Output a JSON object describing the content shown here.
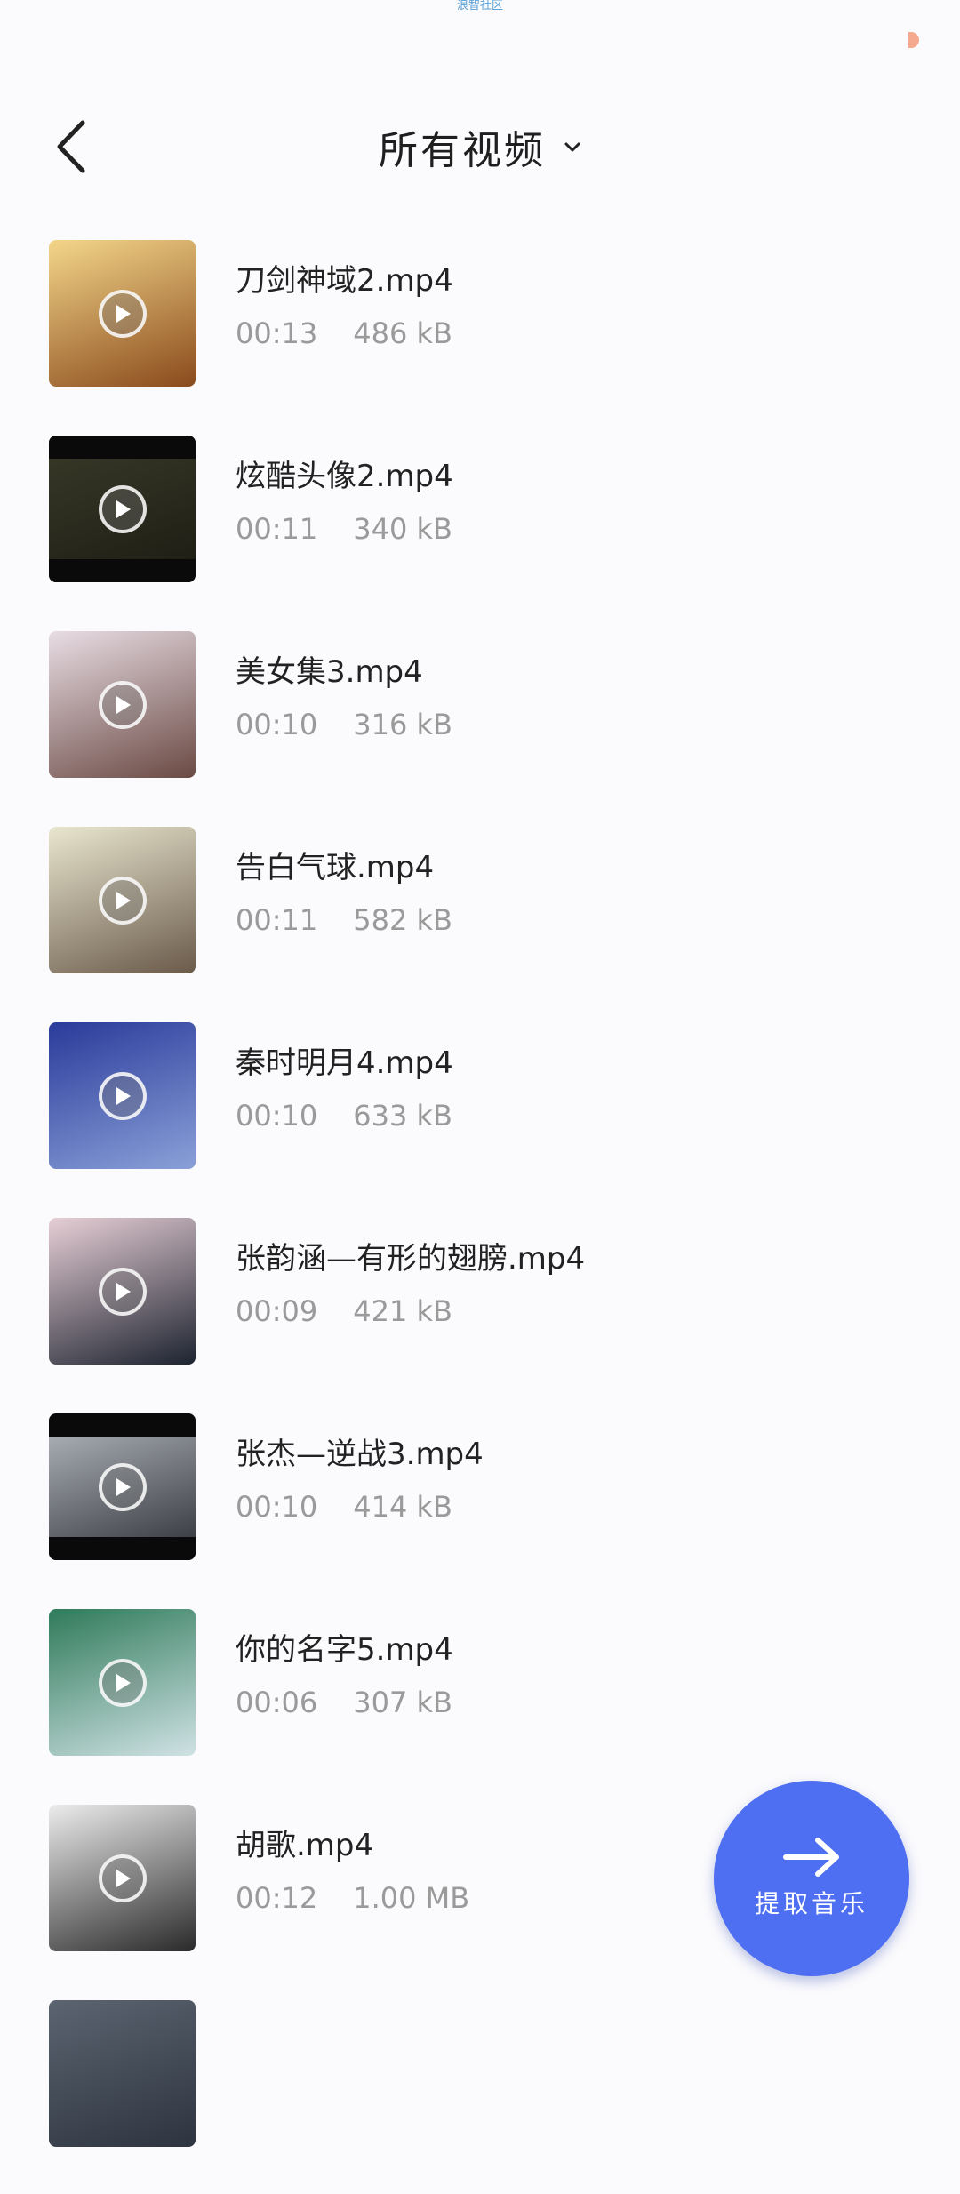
{
  "status": {
    "watermark_text": "浪智社区"
  },
  "header": {
    "title": "所有视频",
    "back_icon": "chevron-left-icon",
    "dropdown_icon": "chevron-down-icon"
  },
  "videos": [
    {
      "title": "刀剑神域2.mp4",
      "duration": "00:13",
      "size": "486 kB",
      "thumb_colors": [
        "#f3d68a",
        "#8a4a1c"
      ]
    },
    {
      "title": "炫酷头像2.mp4",
      "duration": "00:11",
      "size": "340 kB",
      "thumb_colors": [
        "#3a3a2a",
        "#1b1b12"
      ]
    },
    {
      "title": "美女集3.mp4",
      "duration": "00:10",
      "size": "316 kB",
      "thumb_colors": [
        "#e8dde4",
        "#6b4a44"
      ]
    },
    {
      "title": "告白气球.mp4",
      "duration": "00:11",
      "size": "582 kB",
      "thumb_colors": [
        "#e9e6cf",
        "#6a5a4a"
      ]
    },
    {
      "title": "秦时明月4.mp4",
      "duration": "00:10",
      "size": "633 kB",
      "thumb_colors": [
        "#2a3a9a",
        "#8aa0d8"
      ]
    },
    {
      "title": "张韵涵—有形的翅膀.mp4",
      "duration": "00:09",
      "size": "421 kB",
      "thumb_colors": [
        "#e7cfd6",
        "#1d2330"
      ]
    },
    {
      "title": "张杰—逆战3.mp4",
      "duration": "00:10",
      "size": "414 kB",
      "thumb_colors": [
        "#b7bcc2",
        "#2d3036"
      ]
    },
    {
      "title": "你的名字5.mp4",
      "duration": "00:06",
      "size": "307 kB",
      "thumb_colors": [
        "#2f7a5a",
        "#cfe2e4"
      ]
    },
    {
      "title": "胡歌.mp4",
      "duration": "00:12",
      "size": "1.00 MB",
      "thumb_colors": [
        "#ececec",
        "#2a2a2a"
      ]
    },
    {
      "title": "",
      "duration": "",
      "size": "",
      "thumb_colors": [
        "#5b6470",
        "#2d3440"
      ]
    }
  ],
  "fab": {
    "label": "提取音乐",
    "icon": "arrow-right-icon",
    "color": "#4f6ff2"
  }
}
